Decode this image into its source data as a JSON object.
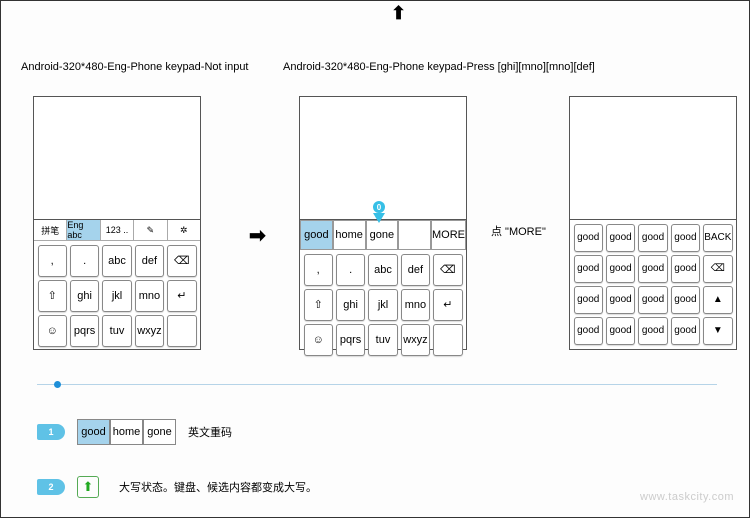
{
  "top_arrow": "⬆",
  "titles": {
    "t1": "Android-320*480-Eng-Phone keypad-Not input",
    "t2": "Android-320*480-Eng-Phone keypad-Press [ghi][mno][mno][def]"
  },
  "tabs": [
    "拼笔",
    "Eng abc",
    "123 ..",
    "✎",
    "✲"
  ],
  "tab_active_index": 1,
  "keypad_rows": [
    [
      ",",
      ".",
      "abc",
      "def",
      "⌫"
    ],
    [
      "⇧",
      "ghi",
      "jkl",
      "mno",
      "↵"
    ],
    [
      "☺",
      "pqrs",
      "tuv",
      "wxyz",
      ""
    ]
  ],
  "arrow_right": "➡",
  "candidates": [
    "good",
    "home",
    "gone",
    "",
    "MORE"
  ],
  "cursor_badge": "0",
  "more_label": "点 \"MORE\"",
  "phone3_word": "good",
  "phone3_last_col": [
    "BACK",
    "⌫",
    "▲",
    "▼"
  ],
  "legend": {
    "badge1": "1",
    "cands": [
      "good",
      "home",
      "gone"
    ],
    "text1": "英文重码",
    "badge2": "2",
    "shift_icon": "⬆",
    "text2": "大写状态。键盘、候选内容都变成大写。"
  },
  "watermark": "www.taskcity.com"
}
